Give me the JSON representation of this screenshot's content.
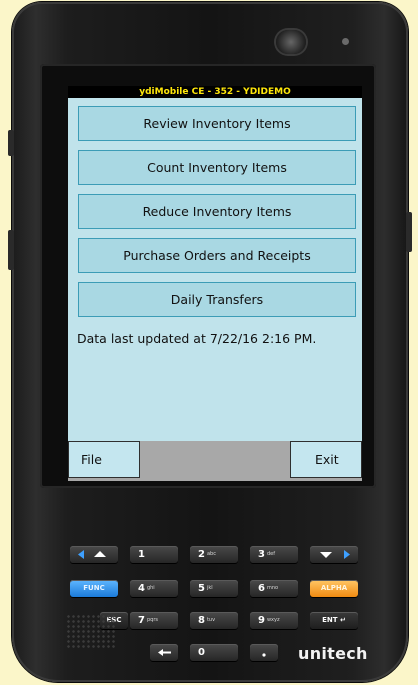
{
  "window": {
    "title": "ydiMobile CE - 352 - YDIDEMO"
  },
  "menu": [
    {
      "label": "Review Inventory Items"
    },
    {
      "label": "Count Inventory Items"
    },
    {
      "label": "Reduce Inventory Items"
    },
    {
      "label": "Purchase Orders and Receipts"
    },
    {
      "label": "Daily Transfers"
    }
  ],
  "status": {
    "text": "Data last updated at 7/22/16 2:16 PM."
  },
  "footer": {
    "file_label": "File",
    "exit_label": "Exit"
  },
  "device": {
    "brand": "unitech"
  },
  "keypad": {
    "k1": "1",
    "k2": "2",
    "k2s": "abc",
    "k3": "3",
    "k3s": "def",
    "k4": "4",
    "k4s": "ghi",
    "k5": "5",
    "k5s": "jkl",
    "k6": "6",
    "k6s": "mno",
    "k7": "7",
    "k7s": "pqrs",
    "k8": "8",
    "k8s": "tuv",
    "k9": "9",
    "k9s": "wxyz",
    "k0": "0",
    "esc": "ESC",
    "ent": "ENT ↵",
    "blue": "FUNC",
    "alpha": "ALPHA"
  },
  "colors": {
    "screen_bg": "#c0e3eb",
    "button_bg": "#a9d8e3",
    "title_text": "#ffe70a"
  }
}
